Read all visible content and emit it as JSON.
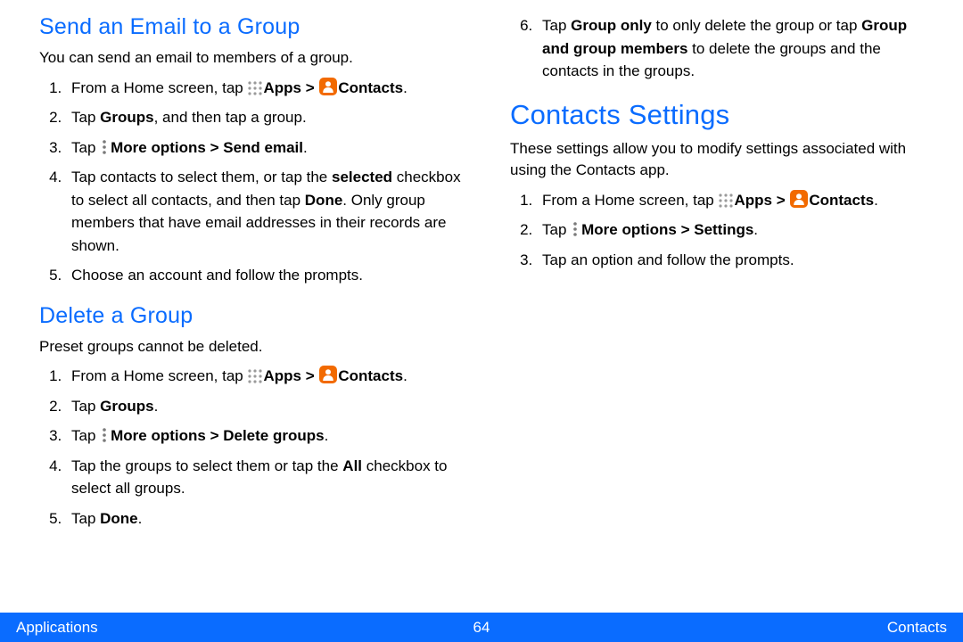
{
  "left": {
    "section1": {
      "heading": "Send an Email to a Group",
      "intro": "You can send an email to members of a group.",
      "step1_pre": "From a Home screen, tap ",
      "apps_label": "Apps > ",
      "contacts_label": "Contacts",
      "step1_post": ".",
      "step2_a": "Tap ",
      "step2_b": "Groups",
      "step2_c": ", and then tap a group.",
      "step3_a": "Tap ",
      "step3_b": "More options > Send email",
      "step3_c": ".",
      "step4_a": "Tap contacts to select them, or tap the ",
      "step4_b": "selected",
      "step4_c": " checkbox to select all contacts, and then tap ",
      "step4_d": "Done",
      "step4_e": ". Only group members that have email addresses in their records are shown.",
      "step5": "Choose an account and follow the prompts."
    },
    "section2": {
      "heading": "Delete a Group",
      "intro": "Preset groups cannot be deleted.",
      "step1_pre": "From a Home screen, tap ",
      "apps_label": "Apps > ",
      "contacts_label": "Contacts",
      "step1_post": ".",
      "step2_a": "Tap ",
      "step2_b": "Groups",
      "step2_c": ".",
      "step3_a": "Tap ",
      "step3_b": "More options > Delete groups",
      "step3_c": ".",
      "step4_a": "Tap the groups to select them or tap the ",
      "step4_b": "All",
      "step4_c": " checkbox to select all groups.",
      "step5_a": "Tap ",
      "step5_b": "Done",
      "step5_c": "."
    }
  },
  "right": {
    "cont_step6_a": "Tap ",
    "cont_step6_b": "Group only",
    "cont_step6_c": " to only delete the group or tap ",
    "cont_step6_d": "Group and group members",
    "cont_step6_e": " to delete the groups and the contacts in the groups.",
    "section3": {
      "heading": "Contacts Settings",
      "intro": "These settings allow you to modify settings associated with using the Contacts app.",
      "step1_pre": "From a Home screen, tap ",
      "apps_label": "Apps > ",
      "contacts_label": "Contacts",
      "step1_post": ".",
      "step2_a": "Tap ",
      "step2_b": "More options > Settings",
      "step2_c": ".",
      "step3": "Tap an option and follow the prompts."
    }
  },
  "footer": {
    "left": "Applications",
    "page": "64",
    "right": "Contacts"
  }
}
